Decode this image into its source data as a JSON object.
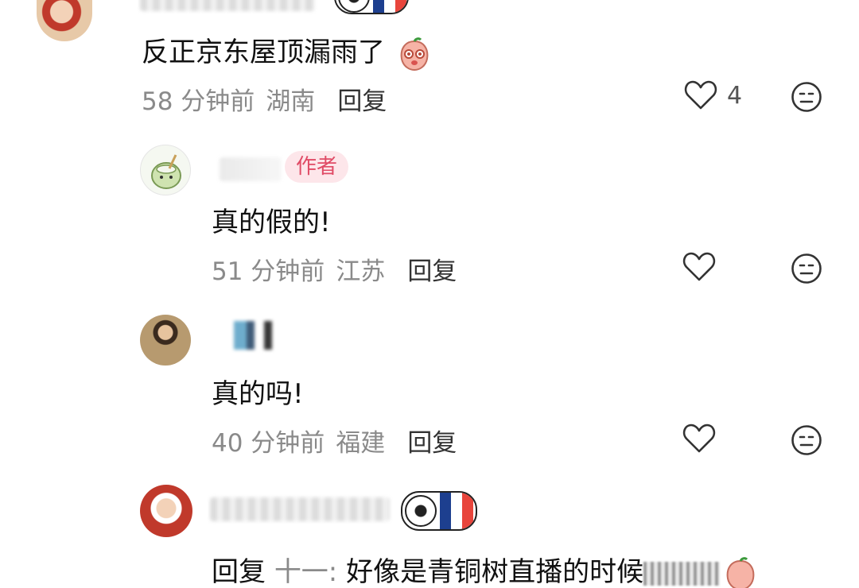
{
  "comments": [
    {
      "text": "反正京东屋顶漏雨了",
      "time": "58 分钟前",
      "location": "湖南",
      "reply_label": "回复",
      "likes": "4"
    },
    {
      "badge": "作者",
      "text": "真的假的!",
      "time": "51 分钟前",
      "location": "江苏",
      "reply_label": "回复"
    },
    {
      "text": "真的吗!",
      "time": "40 分钟前",
      "location": "福建",
      "reply_label": "回复"
    },
    {
      "reply_prefix": "回复",
      "reply_target": "十一:",
      "text": "好像是青铜树直播的时候"
    }
  ],
  "colors": {
    "accent_badge": "#e04b66",
    "flag_blue": "#1d3f8f",
    "flag_red": "#e8453c"
  },
  "icons": [
    "heart-icon",
    "expressionless-face-icon",
    "peach-sticker-icon",
    "soccer-ball-icon"
  ]
}
